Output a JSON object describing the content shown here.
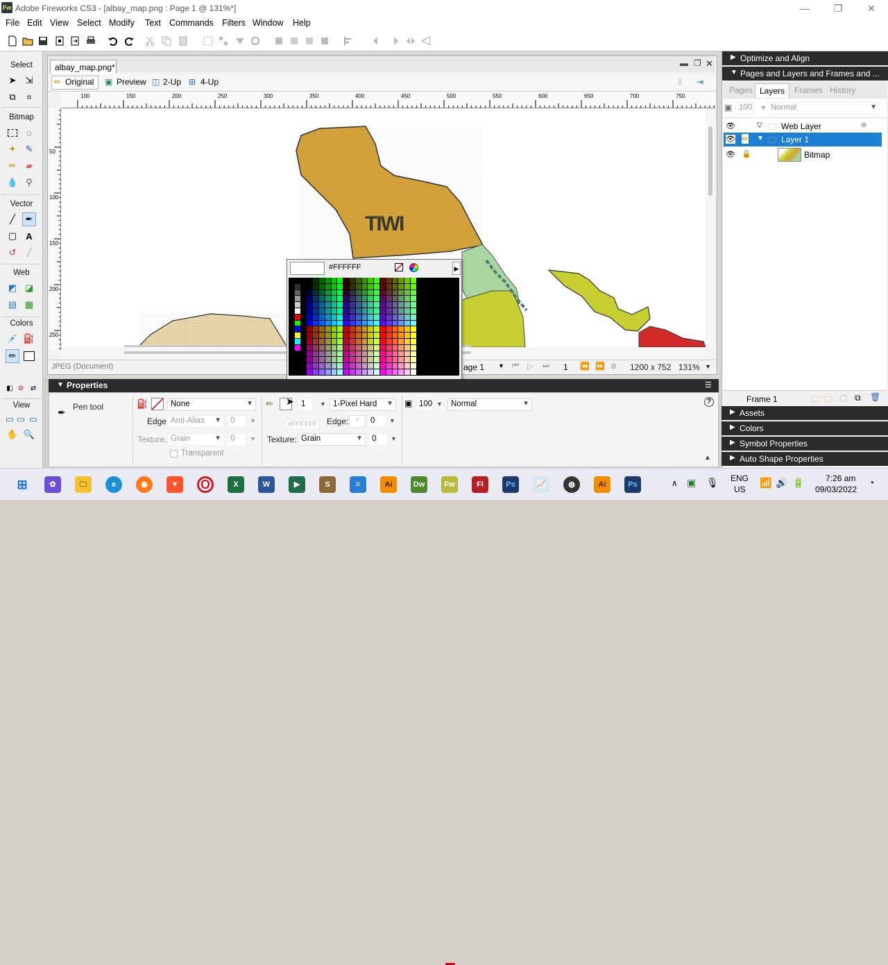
{
  "window": {
    "title": "Adobe Fireworks CS3 - [albay_map.png : Page 1 @ 131%*]",
    "app_badge": "Fw",
    "controls": [
      "—",
      "❐",
      "✕"
    ]
  },
  "menu": [
    "File",
    "Edit",
    "View",
    "Select",
    "Modify",
    "Text",
    "Commands",
    "Filters",
    "Window",
    "Help"
  ],
  "tools": {
    "sections": [
      "Select",
      "Bitmap",
      "Vector",
      "Web",
      "Colors",
      "View"
    ]
  },
  "document": {
    "tab": "albay_map.png*",
    "views": [
      "Original",
      "Preview",
      "2-Up",
      "4-Up"
    ],
    "ruler_h": [
      "100",
      "150",
      "200",
      "250",
      "300",
      "350",
      "400",
      "450",
      "500",
      "550",
      "600",
      "650",
      "700",
      "750"
    ],
    "ruler_v": [
      "50",
      "100",
      "150",
      "200",
      "250"
    ],
    "map_label": "TIWI",
    "status_format": "JPEG (Document)",
    "page_select": "age 1",
    "frame_number": "1",
    "dimensions": "1200 x 752",
    "zoom": "131%"
  },
  "swatch_popup": {
    "hex": "#FFFFFF",
    "tooltip_hex": "#FFFFFF"
  },
  "properties": {
    "header": "Properties",
    "tool_name": "Pen tool",
    "fill_value": "None",
    "edge_label": "Edge:",
    "edge_fill": "Anti-Alias",
    "edge_fill_amount": "0",
    "texture_label": "Texture:",
    "texture_fill": "Grain",
    "texture_fill_amount": "0",
    "transparent_label": "Transparent",
    "stroke_size": "1",
    "stroke_type": "1-Pixel Hard",
    "stroke_edge": "0",
    "stroke_texture": "Grain",
    "stroke_texture_amount": "0",
    "opacity": "100",
    "blend": "Normal"
  },
  "right_panel": {
    "optimize": "Optimize and Align",
    "pages_layers": "Pages and Layers and Frames and ...",
    "tabs": [
      "Pages",
      "Layers",
      "Frames",
      "History"
    ],
    "active_tab": "Layers",
    "opacity": "100",
    "blend": "Normal",
    "layers": [
      "Web Layer",
      "Layer 1",
      "Bitmap"
    ],
    "frame": "Frame 1",
    "collapsed": [
      "Assets",
      "Colors",
      "Symbol Properties",
      "Auto Shape Properties"
    ]
  },
  "taskbar": {
    "apps": [
      "Ai",
      "Dw",
      "Fw",
      "Fl",
      "Ps",
      "Ai",
      "Ps"
    ],
    "lang": "ENG",
    "region": "US",
    "time": "7:26 am",
    "date": "09/03/2022"
  },
  "colors": {
    "accent": "#0a64c8",
    "selection": "#1c7fd6",
    "map_tiwi": "#d4a23a",
    "map_green": "#a9d6a0",
    "map_lime": "#c8cf30",
    "map_red": "#d42a2a",
    "map_sand": "#e8d5a8"
  }
}
